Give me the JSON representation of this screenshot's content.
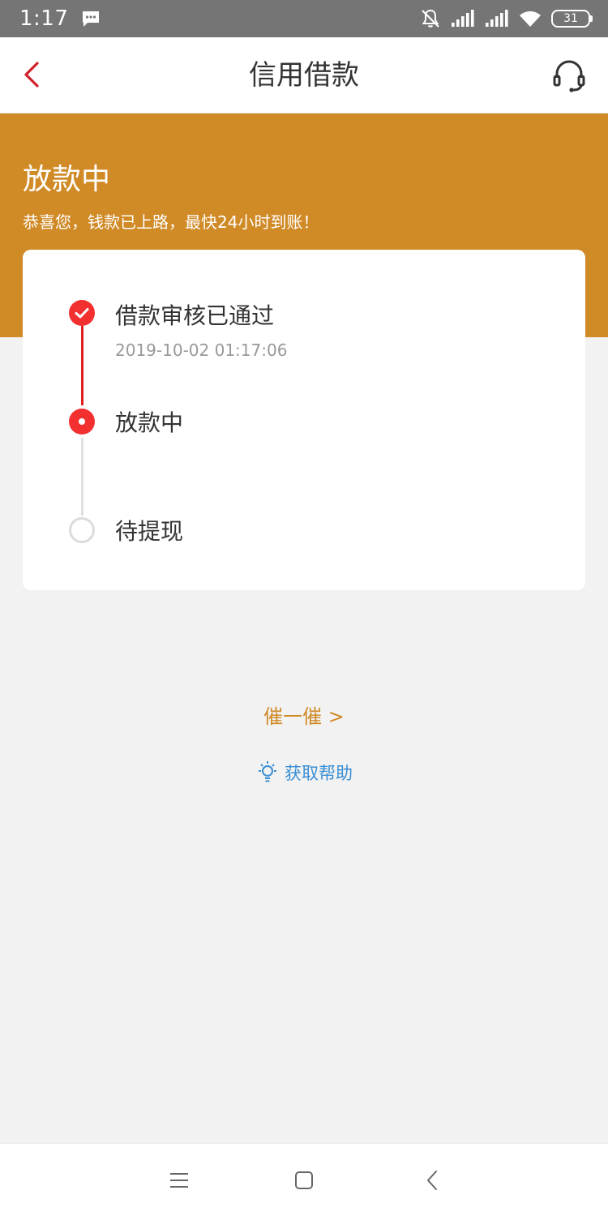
{
  "status_bar": {
    "time": "1:17",
    "battery": "31",
    "icons": [
      "message-icon",
      "mute-bell-icon",
      "signal-icon",
      "signal-icon",
      "wifi-icon",
      "battery-icon"
    ]
  },
  "nav": {
    "title": "信用借款",
    "back_icon": "chevron-left-icon",
    "service_icon": "headset-icon"
  },
  "banner": {
    "title": "放款中",
    "subtitle": "恭喜您，钱款已上路，最快24小时到账！"
  },
  "steps": [
    {
      "label": "借款审核已通过",
      "time": "2019-10-02 01:17:06",
      "state": "done"
    },
    {
      "label": "放款中",
      "state": "current"
    },
    {
      "label": "待提现",
      "state": "pending"
    }
  ],
  "actions": {
    "urge_label": "催一催 >",
    "help_label": "获取帮助",
    "help_icon": "lightbulb-icon"
  },
  "system_nav": {
    "icons": [
      "menu-icon",
      "home-icon",
      "back-icon"
    ]
  },
  "colors": {
    "accent": "#d08a26",
    "primary_red": "#f23030",
    "link_blue": "#3a8ed4",
    "background": "#f2f2f2"
  }
}
